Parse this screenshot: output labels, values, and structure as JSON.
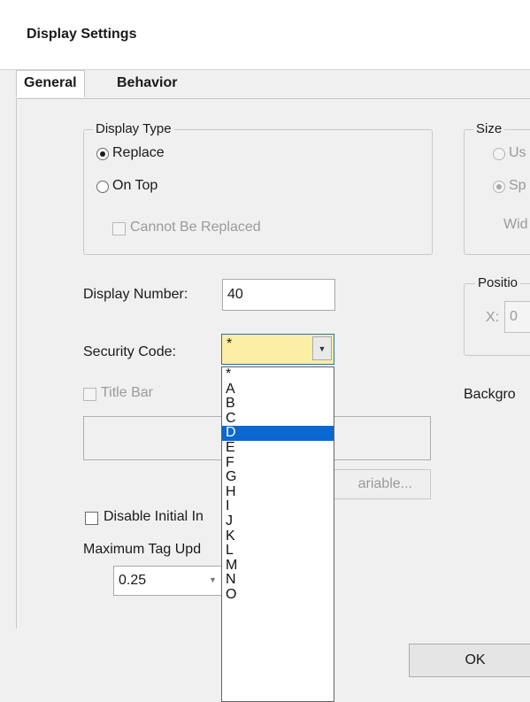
{
  "window": {
    "title": "Display Settings"
  },
  "tabs": [
    {
      "label": "General",
      "active": true
    },
    {
      "label": "Behavior",
      "active": false
    }
  ],
  "display_type": {
    "group_label": "Display Type",
    "options": [
      {
        "label": "Replace",
        "checked": true
      },
      {
        "label": "On Top",
        "checked": false
      }
    ],
    "cannot_be_replaced": {
      "label": "Cannot Be Replaced",
      "checked": false,
      "enabled": false
    }
  },
  "size": {
    "group_label": "Size",
    "option1_partial": "Us",
    "option2_partial": "Sp",
    "width_partial": "Wid"
  },
  "position": {
    "group_label": "Positio",
    "x_label": "X:",
    "x_value": "0"
  },
  "background_partial": "Backgro",
  "display_number": {
    "label": "Display Number:",
    "value": "40"
  },
  "security_code": {
    "label": "Security Code:",
    "value": "*",
    "options": [
      "*",
      "A",
      "B",
      "C",
      "D",
      "E",
      "F",
      "G",
      "H",
      "I",
      "J",
      "K",
      "L",
      "M",
      "N",
      "O"
    ],
    "highlighted": "D"
  },
  "title_bar": {
    "label": "Title Bar",
    "checked": false,
    "enabled": false
  },
  "variable_button": {
    "label": "ariable..."
  },
  "disable_initial": {
    "label": "Disable Initial In",
    "checked": false
  },
  "max_tag_update": {
    "label": "Maximum Tag Upd",
    "value": "0.25"
  },
  "footer": {
    "ok_label": "OK"
  }
}
